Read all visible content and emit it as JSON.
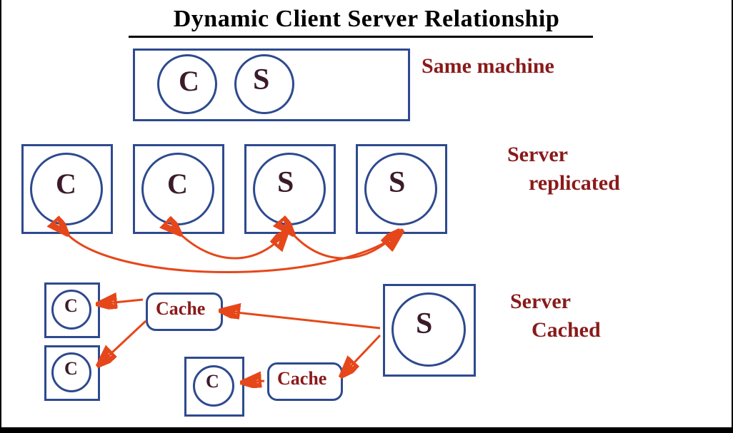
{
  "title": "Dynamic Client Server Relationship",
  "notes": {
    "same": "Same machine",
    "replicated_l1": "Server",
    "replicated_l2": "replicated",
    "cached_l1": "Server",
    "cached_l2": "Cached"
  },
  "glyph": {
    "c": "C",
    "s": "S"
  },
  "cache": "Cache"
}
